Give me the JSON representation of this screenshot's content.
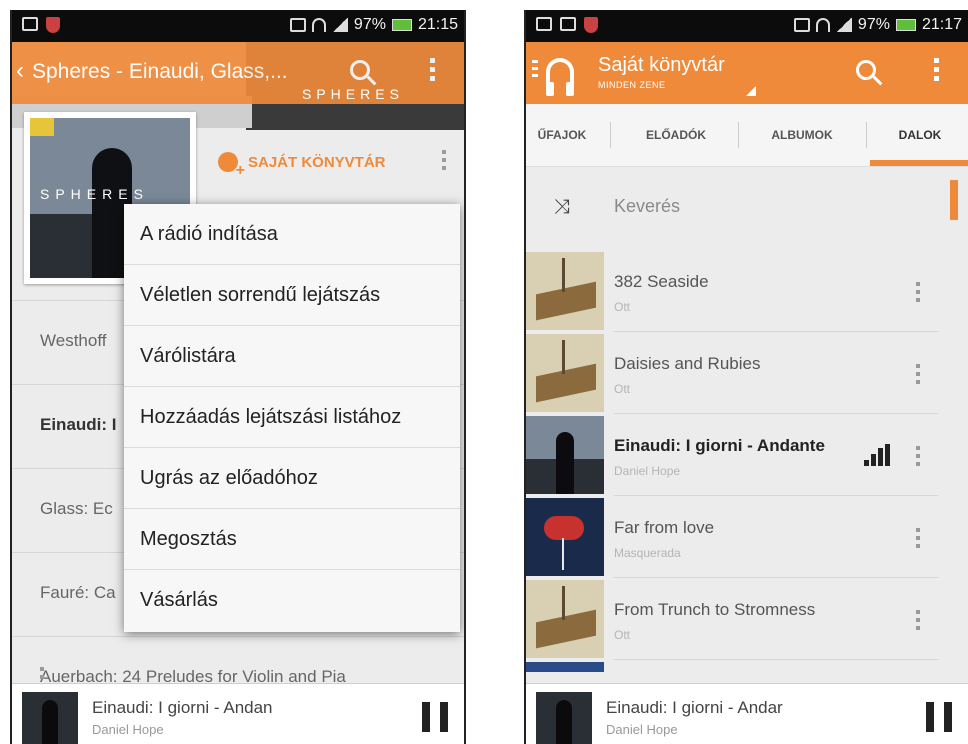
{
  "left": {
    "status": {
      "battery": "97%",
      "time": "21:15"
    },
    "actionbar": {
      "title": "Spheres - Einaudi, Glass,..."
    },
    "album": {
      "cover_word": "SPHERES",
      "header_subtitle": "SPHERES",
      "library_label": "SAJÁT KÖNYVTÁR"
    },
    "tracks": [
      {
        "title": "Westhoff",
        "bold": false
      },
      {
        "title": "Einaudi: I",
        "bold": true
      },
      {
        "title": "Glass: Ec",
        "bold": false
      },
      {
        "title": "Fauré: Ca",
        "bold": false
      },
      {
        "title": "Auerbach: 24 Preludes for Violin and Pia",
        "bold": false
      }
    ],
    "menu": [
      "A rádió indítása",
      "Véletlen sorrendű lejátszás",
      "Várólistára",
      "Hozzáadás lejátszási listához",
      "Ugrás az előadóhoz",
      "Megosztás",
      "Vásárlás"
    ],
    "nowplaying": {
      "title": "Einaudi: I giorni - Andan",
      "artist": "Daniel Hope"
    }
  },
  "right": {
    "status": {
      "battery": "97%",
      "time": "21:17"
    },
    "actionbar": {
      "title": "Saját könyvtár",
      "subtitle": "MINDEN ZENE"
    },
    "tabs": [
      "ŰFAJOK",
      "ELŐADÓK",
      "ALBUMOK",
      "DALOK"
    ],
    "active_tab": "DALOK",
    "shuffle_label": "Keverés",
    "songs": [
      {
        "title": "382 Seaside",
        "artist": "Ott",
        "thumb": "ship"
      },
      {
        "title": "Daisies and Rubies",
        "artist": "Ott",
        "thumb": "ship"
      },
      {
        "title": "Einaudi: I giorni - Andante",
        "artist": "Daniel Hope",
        "thumb": "spheres",
        "playing": true
      },
      {
        "title": "Far from love",
        "artist": "Masquerada",
        "thumb": "masq"
      },
      {
        "title": "From Trunch to Stromness",
        "artist": "Ott",
        "thumb": "ship"
      }
    ],
    "nowplaying": {
      "title": "Einaudi: I giorni - Andar",
      "artist": "Daniel Hope"
    }
  },
  "colors": {
    "accent": "#ef8a3a",
    "statusbar": "#0c0c0c"
  },
  "icons": [
    "mail-icon",
    "shield-icon",
    "signal-icon",
    "wifi-icon",
    "battery-icon",
    "search-icon",
    "overflow-menu-icon",
    "headphones-icon",
    "shuffle-icon",
    "pause-icon",
    "equalizer-icon",
    "add-to-library-icon"
  ]
}
